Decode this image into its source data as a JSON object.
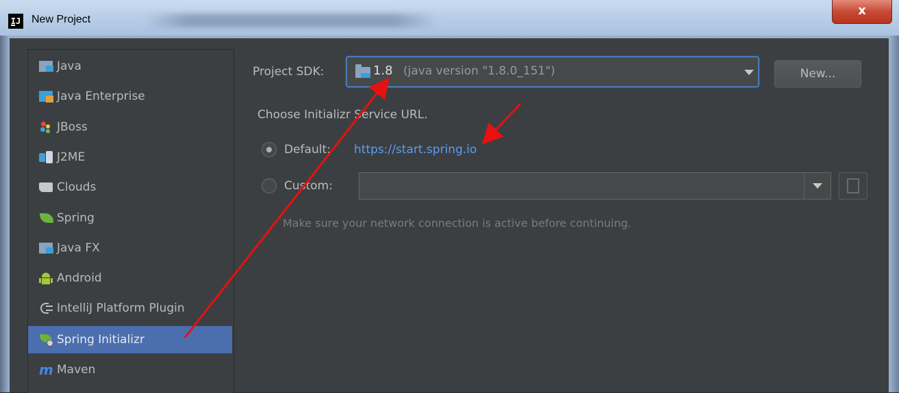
{
  "window": {
    "title": "New Project",
    "app_icon_text": "IJ",
    "close_label": "x"
  },
  "sidebar": {
    "items": [
      {
        "label": "Java",
        "icon": "java-folder-icon",
        "selected": false
      },
      {
        "label": "Java Enterprise",
        "icon": "java-enterprise-icon",
        "selected": false
      },
      {
        "label": "JBoss",
        "icon": "jboss-icon",
        "selected": false
      },
      {
        "label": "J2ME",
        "icon": "j2me-icon",
        "selected": false
      },
      {
        "label": "Clouds",
        "icon": "clouds-icon",
        "selected": false
      },
      {
        "label": "Spring",
        "icon": "spring-leaf-icon",
        "selected": false
      },
      {
        "label": "Java FX",
        "icon": "javafx-folder-icon",
        "selected": false
      },
      {
        "label": "Android",
        "icon": "android-icon",
        "selected": false
      },
      {
        "label": "IntelliJ Platform Plugin",
        "icon": "plugin-icon",
        "selected": false
      },
      {
        "label": "Spring Initializr",
        "icon": "spring-initializr-icon",
        "selected": true
      },
      {
        "label": "Maven",
        "icon": "maven-icon",
        "selected": false
      }
    ]
  },
  "main": {
    "sdk_label": "Project SDK:",
    "sdk_version": "1.8",
    "sdk_description": "(java version \"1.8.0_151\")",
    "new_button": "New...",
    "service_url_heading": "Choose Initializr Service URL.",
    "default_label": "Default:",
    "default_url": "https://start.spring.io",
    "custom_label": "Custom:",
    "custom_value": "",
    "note": "Make sure your network connection is active before continuing."
  },
  "colors": {
    "background": "#3c3f41",
    "selection": "#4b6eaf",
    "link": "#589df6",
    "annotation_arrow": "#e81010"
  }
}
